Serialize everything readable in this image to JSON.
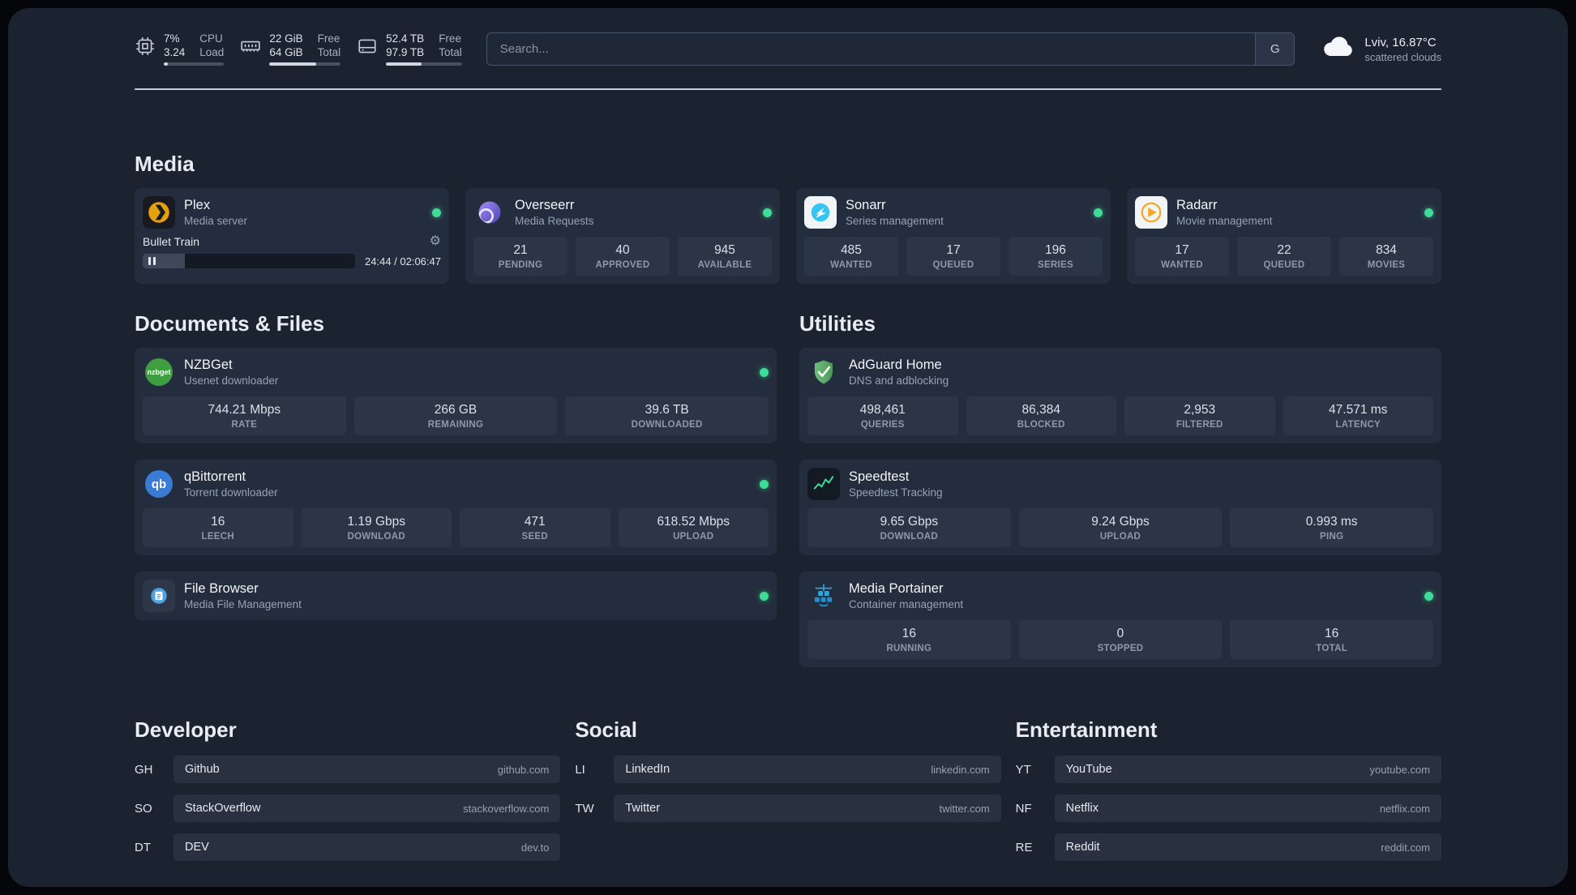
{
  "header": {
    "resources": [
      {
        "line1_value": "7%",
        "line1_label": "CPU",
        "line2_value": "3.24",
        "line2_label": "Load",
        "progress": 7
      },
      {
        "line1_value": "22 GiB",
        "line1_label": "Free",
        "line2_value": "64 GiB",
        "line2_label": "Total",
        "progress": 66
      },
      {
        "line1_value": "52.4 TB",
        "line1_label": "Free",
        "line2_value": "97.9 TB",
        "line2_label": "Total",
        "progress": 47
      }
    ],
    "search": {
      "placeholder": "Search...",
      "provider": "G"
    },
    "weather": {
      "location": "Lviv, 16.87°C",
      "condition": "scattered clouds"
    }
  },
  "colors": {
    "status_online": "#3ddc97",
    "panel": "#1b2331",
    "card": "#242d3d"
  },
  "sections": {
    "media": {
      "title": "Media",
      "plex": {
        "name": "Plex",
        "description": "Media server",
        "now_playing": "Bullet Train",
        "time": "24:44 / 02:06:47",
        "progress": 20
      },
      "overseerr": {
        "name": "Overseerr",
        "description": "Media Requests",
        "stats": [
          {
            "value": "21",
            "label": "PENDING"
          },
          {
            "value": "40",
            "label": "APPROVED"
          },
          {
            "value": "945",
            "label": "AVAILABLE"
          }
        ]
      },
      "sonarr": {
        "name": "Sonarr",
        "description": "Series management",
        "stats": [
          {
            "value": "485",
            "label": "WANTED"
          },
          {
            "value": "17",
            "label": "QUEUED"
          },
          {
            "value": "196",
            "label": "SERIES"
          }
        ]
      },
      "radarr": {
        "name": "Radarr",
        "description": "Movie management",
        "stats": [
          {
            "value": "17",
            "label": "WANTED"
          },
          {
            "value": "22",
            "label": "QUEUED"
          },
          {
            "value": "834",
            "label": "MOVIES"
          }
        ]
      }
    },
    "documents": {
      "title": "Documents & Files",
      "nzbget": {
        "name": "NZBGet",
        "description": "Usenet downloader",
        "icon_text": "nzbget",
        "stats": [
          {
            "value": "744.21 Mbps",
            "label": "RATE"
          },
          {
            "value": "266 GB",
            "label": "REMAINING"
          },
          {
            "value": "39.6 TB",
            "label": "DOWNLOADED"
          }
        ]
      },
      "qbittorrent": {
        "name": "qBittorrent",
        "description": "Torrent downloader",
        "icon_text": "qb",
        "stats": [
          {
            "value": "16",
            "label": "LEECH"
          },
          {
            "value": "1.19 Gbps",
            "label": "DOWNLOAD"
          },
          {
            "value": "471",
            "label": "SEED"
          },
          {
            "value": "618.52 Mbps",
            "label": "UPLOAD"
          }
        ]
      },
      "filebrowser": {
        "name": "File Browser",
        "description": "Media File Management"
      }
    },
    "utilities": {
      "title": "Utilities",
      "adguard": {
        "name": "AdGuard Home",
        "description": "DNS and adblocking",
        "stats": [
          {
            "value": "498,461",
            "label": "QUERIES"
          },
          {
            "value": "86,384",
            "label": "BLOCKED"
          },
          {
            "value": "2,953",
            "label": "FILTERED"
          },
          {
            "value": "47.571 ms",
            "label": "LATENCY"
          }
        ]
      },
      "speedtest": {
        "name": "Speedtest",
        "description": "Speedtest Tracking",
        "stats": [
          {
            "value": "9.65 Gbps",
            "label": "DOWNLOAD"
          },
          {
            "value": "9.24 Gbps",
            "label": "UPLOAD"
          },
          {
            "value": "0.993 ms",
            "label": "PING"
          }
        ]
      },
      "portainer": {
        "name": "Media Portainer",
        "description": "Container management",
        "stats": [
          {
            "value": "16",
            "label": "RUNNING"
          },
          {
            "value": "0",
            "label": "STOPPED"
          },
          {
            "value": "16",
            "label": "TOTAL"
          }
        ]
      }
    }
  },
  "bookmarks": {
    "developer": {
      "title": "Developer",
      "items": [
        {
          "abbr": "GH",
          "name": "Github",
          "url": "github.com"
        },
        {
          "abbr": "SO",
          "name": "StackOverflow",
          "url": "stackoverflow.com"
        },
        {
          "abbr": "DT",
          "name": "DEV",
          "url": "dev.to"
        }
      ]
    },
    "social": {
      "title": "Social",
      "items": [
        {
          "abbr": "LI",
          "name": "LinkedIn",
          "url": "linkedin.com"
        },
        {
          "abbr": "TW",
          "name": "Twitter",
          "url": "twitter.com"
        }
      ]
    },
    "entertainment": {
      "title": "Entertainment",
      "items": [
        {
          "abbr": "YT",
          "name": "YouTube",
          "url": "youtube.com"
        },
        {
          "abbr": "NF",
          "name": "Netflix",
          "url": "netflix.com"
        },
        {
          "abbr": "RE",
          "name": "Reddit",
          "url": "reddit.com"
        }
      ]
    }
  }
}
